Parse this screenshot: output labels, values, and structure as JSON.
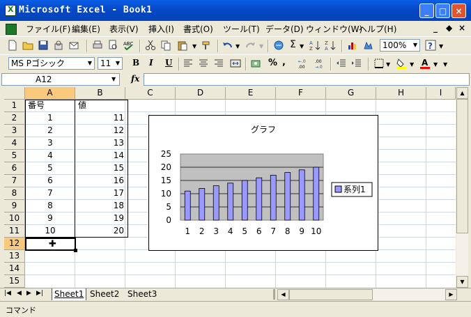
{
  "title": "Microsoft Excel - Book1",
  "menu": [
    "ファイル(F)",
    "編集(E)",
    "表示(V)",
    "挿入(I)",
    "書式(O)",
    "ツール(T)",
    "データ(D)",
    "ウィンドウ(W)",
    "ヘルプ(H)"
  ],
  "mdi_controls": [
    "_",
    "◆",
    "×"
  ],
  "toolbar": {
    "zoom": "100%",
    "font_name": "MS Pゴシック",
    "font_size": "11",
    "bold": "B",
    "italic": "I",
    "underline": "U",
    "sigma": "Σ",
    "percent": "%"
  },
  "formula_bar": {
    "name_box": "A12",
    "fx": "fx",
    "formula": ""
  },
  "columns": [
    "A",
    "B",
    "C",
    "D",
    "E",
    "F",
    "G",
    "H",
    "I"
  ],
  "rows": [
    "1",
    "2",
    "3",
    "4",
    "5",
    "6",
    "7",
    "8",
    "9",
    "10",
    "11",
    "12",
    "13",
    "14",
    "15"
  ],
  "cells": {
    "A1": "番号",
    "B1": "値",
    "A": [
      "1",
      "2",
      "3",
      "4",
      "5",
      "6",
      "7",
      "8",
      "9",
      "10"
    ],
    "B": [
      "11",
      "12",
      "13",
      "14",
      "15",
      "16",
      "17",
      "18",
      "19",
      "20"
    ]
  },
  "chart_data": {
    "type": "bar",
    "title": "グラフ",
    "categories": [
      "1",
      "2",
      "3",
      "4",
      "5",
      "6",
      "7",
      "8",
      "9",
      "10"
    ],
    "series": [
      {
        "name": "系列1",
        "values": [
          11,
          12,
          13,
          14,
          15,
          16,
          17,
          18,
          19,
          20
        ],
        "color": "#9999ff"
      }
    ],
    "ylim": [
      0,
      25
    ],
    "yticks": [
      "0",
      "5",
      "10",
      "15",
      "20",
      "25"
    ],
    "legend": "right",
    "plot_background": "#c0c0c0",
    "grid": true
  },
  "sheets": [
    "Sheet1",
    "Sheet2",
    "Sheet3"
  ],
  "status": "コマンド",
  "colors": {
    "title_bar": "#0548c6",
    "selected_header": "#fbc97c",
    "chrome": "#ece9d8",
    "bar": "#9999ff"
  }
}
